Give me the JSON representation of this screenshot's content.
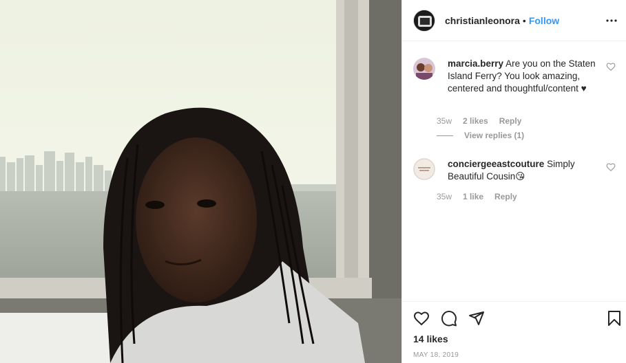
{
  "post": {
    "username": "christianleonora",
    "separator": "•",
    "follow_label": "Follow",
    "more_icon": "more-options-icon",
    "likes_text": "14 likes",
    "date": "MAY 18, 2019"
  },
  "comments": [
    {
      "username": "marcia.berry",
      "text": " Are you on the Staten Island Ferry? You look amazing, centered and thoughtful/content ♥",
      "time": "35w",
      "likes": "2 likes",
      "reply_label": "Reply",
      "view_replies": "View replies (1)"
    },
    {
      "username": "conciergeeastcouture",
      "text": " Simply Beautiful Cousin😘",
      "time": "35w",
      "likes": "1 like",
      "reply_label": "Reply"
    }
  ],
  "icons": {
    "like": "heart-icon",
    "comment": "comment-icon",
    "share": "share-icon",
    "save": "bookmark-icon"
  },
  "colors": {
    "accent": "#3897f0",
    "muted": "#999999",
    "text": "#262626",
    "border": "#efefef"
  }
}
